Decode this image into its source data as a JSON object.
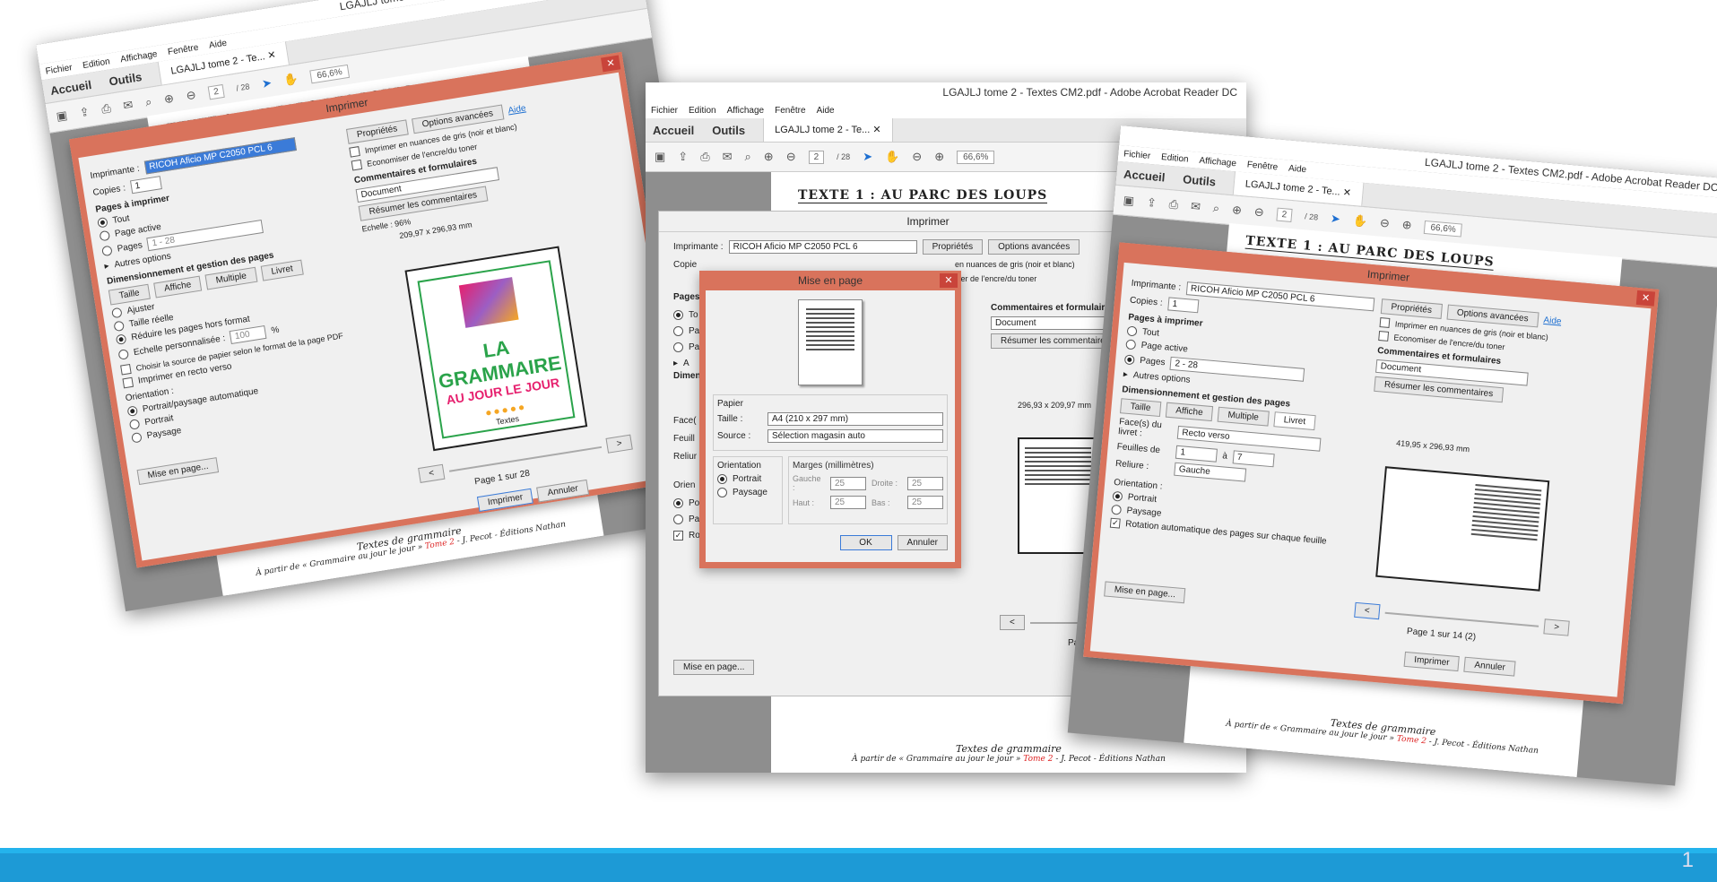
{
  "app": {
    "window_title": "LGAJLJ tome 2 - Textes CM2.pdf - Adobe Acrobat Reader DC",
    "menu": [
      "Fichier",
      "Edition",
      "Affichage",
      "Fenêtre",
      "Aide"
    ],
    "nav_home": "Accueil",
    "nav_tools": "Outils",
    "doc_tab": "LGAJLJ tome 2 - Te...",
    "page_current": "2",
    "page_total": "/ 28",
    "zoom": "66,6%"
  },
  "document": {
    "heading": "TEXTE 1 : AU PARC DES LOUPS",
    "footer_title": "Textes de grammaire",
    "footer_line_a": "À partir de « Grammaire au jour le jour » ",
    "footer_line_red": "Tome 2",
    "footer_line_b": " - J. Pecot - Éditions Nathan"
  },
  "print_dialog": {
    "title": "Imprimer",
    "help": "Aide",
    "printer_label": "Imprimante :",
    "printer_left": "RICOH Aficio MP C2050 PCL 6",
    "printer_name": "RICOH Aficio MP C2050 PCL 6",
    "properties_button": "Propriétés",
    "advanced_button": "Options avancées",
    "copies_label": "Copies :",
    "copies_value": "1",
    "grayscale_label": "Imprimer en nuances de gris (noir et blanc)",
    "grayscale_partial": "en nuances de gris (noir et blanc)",
    "save_ink_label": "Economiser de l'encre/du toner",
    "save_ink_partial": "iser de l'encre/du toner",
    "pages_section": "Pages à imprimer",
    "all_label": "Tout",
    "current_page_label": "Page active",
    "pages_label": "Pages",
    "pages_range": "1 - 28",
    "pages_range_right": "2 - 28",
    "more_options": "Autres options",
    "sizing_section": "Dimensionnement et gestion des pages",
    "size_button": "Taille",
    "poster_button": "Affiche",
    "multiple_button": "Multiple",
    "booklet_button": "Livret",
    "fit_label": "Ajuster",
    "actual_size_label": "Taille réelle",
    "shrink_label": "Réduire les pages hors format",
    "custom_scale_label": "Echelle personnalisée :",
    "custom_scale_value": "100",
    "percent": "%",
    "paper_source_label": "Choisir la source de papier selon le format de la page PDF",
    "duplex_label": "Imprimer en recto verso",
    "orientation_label": "Orientation :",
    "auto_orientation_label": "Portrait/paysage automatique",
    "portrait_label": "Portrait",
    "landscape_label": "Paysage",
    "comments_section": "Commentaires et formulaires",
    "comments_value": "Document",
    "summarize_button": "Résumer les commentaires",
    "scale_text": "Echelle : 96%",
    "preview_size_left": "209,97 x 296,93 mm",
    "preview_size_mid": "296,93 x 209,97 mm",
    "preview_size_right": "419,95 x 296,93 mm",
    "page_of_left": "Page 1 sur 28",
    "page_of_right": "Page 1 sur 14 (2)",
    "page_of_mid": "Pa",
    "print_button": "Imprimer",
    "cancel_button": "Annuler",
    "page_setup_button": "Mise en page...",
    "sides_label": "Face(s) du livret :",
    "sides_value": "Recto verso",
    "sheets_label": "Feuilles de",
    "sheets_from": "1",
    "sheets_to_label": "à",
    "sheets_to": "7",
    "binding_label": "Reliure :",
    "binding_value": "Gauche",
    "auto_rotate_label": "Rotation automatique des pages sur chaque feuille",
    "mid_partials": [
      "Copie",
      "Pages",
      "To",
      "Pa",
      "Pa",
      "A",
      "Dimen",
      "Face(",
      "Feuill",
      "Reliur",
      "Orien",
      "Po",
      "Pa",
      "Ro"
    ],
    "next": ">",
    "prev": "<",
    "info_icon_text": "i"
  },
  "page_setup_dialog": {
    "title": "Mise en page",
    "paper_section": "Papier",
    "size_label": "Taille :",
    "size_value": "A4 (210 x 297 mm)",
    "source_label": "Source :",
    "source_value": "Sélection magasin auto",
    "orientation_section": "Orientation",
    "portrait_label": "Portrait",
    "landscape_label": "Paysage",
    "margins_section": "Marges (millimètres)",
    "left_label": "Gauche :",
    "left_value": "25",
    "right_label": "Droite :",
    "right_value": "25",
    "top_label": "Haut :",
    "top_value": "25",
    "bottom_label": "Bas :",
    "bottom_value": "25",
    "ok_button": "OK",
    "cancel_button": "Annuler"
  },
  "cover": {
    "title": "LA GRAMMAIRE",
    "subtitle": "AU JOUR LE JOUR",
    "author": "Textes"
  },
  "slide": {
    "number": "1"
  }
}
